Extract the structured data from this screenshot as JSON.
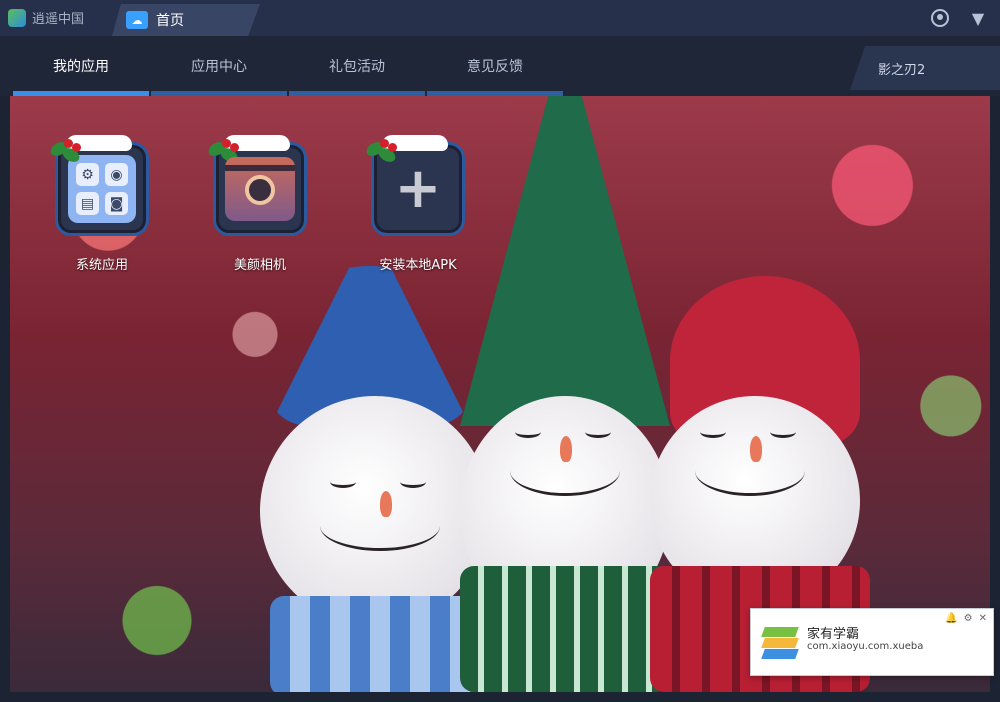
{
  "titlebar": {
    "app_title": "逍遥中国",
    "home_tab_label": "首页",
    "home_tab_icon": "cloud-home-icon"
  },
  "nav": {
    "tabs": [
      {
        "label": "我的应用",
        "active": true
      },
      {
        "label": "应用中心",
        "active": false
      },
      {
        "label": "礼包活动",
        "active": false
      },
      {
        "label": "意见反馈",
        "active": false
      }
    ],
    "game_tab_label": "影之刃2"
  },
  "apps": [
    {
      "label": "系统应用",
      "icon": "system-apps-icon"
    },
    {
      "label": "美颜相机",
      "icon": "beauty-camera-icon"
    },
    {
      "label": "安装本地APK",
      "icon": "plus-icon"
    }
  ],
  "notification": {
    "title": "家有学霸",
    "package": "com.xiaoyu.com.xueba"
  },
  "colors": {
    "accent": "#3a8fe8",
    "titlebar": "#26304a",
    "nav_bg": "#1f2638"
  }
}
